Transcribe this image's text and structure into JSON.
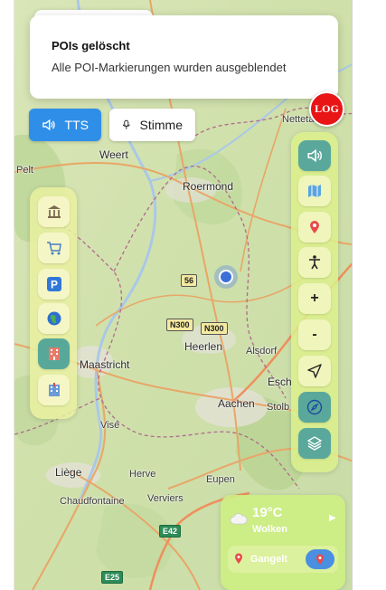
{
  "notification": {
    "title": "POIs gelöscht",
    "message": "Alle POI-Markierungen wurden ausgeblendet"
  },
  "log_button": {
    "label": "LOG"
  },
  "voice_controls": {
    "tts_label": "TTS",
    "voice_label": "Stimme"
  },
  "map": {
    "labels": {
      "weert": "Weert",
      "pelt": "Pelt",
      "roermond": "Roermond",
      "nettetal": "Nettetal",
      "heerlen": "Heerlen",
      "alsdorf": "Alsdorf",
      "maastricht": "Maastricht",
      "aachen": "Aachen",
      "eschweiler": "Esch",
      "stolberg": "Stolb",
      "vise": "Visé",
      "liege": "Liège",
      "herve": "Herve",
      "eupen": "Eupen",
      "chaudfontaine": "Chaudfontaine",
      "verviers": "Verviers"
    },
    "road_shields": {
      "r56": "56",
      "n300a": "N300",
      "n300b": "N300",
      "e42": "E42",
      "e25": "E25"
    }
  },
  "poi_panel": {
    "icons": [
      "museum-icon",
      "shopping-icon",
      "parking-icon",
      "globe-icon",
      "hotel-icon",
      "hospital-icon"
    ],
    "active_index": 4
  },
  "control_panel": {
    "buttons": [
      "speaker-icon",
      "map-icon",
      "pin-icon",
      "accessibility-icon",
      "zoom-in",
      "zoom-out",
      "navigate-icon",
      "compass-icon",
      "layers-icon"
    ],
    "zoom_in_label": "+",
    "zoom_out_label": "-"
  },
  "weather": {
    "temperature": "19°C",
    "condition": "Wolken",
    "location": "Gangelt"
  },
  "colors": {
    "accent_blue": "#2f8fe8",
    "log_red": "#e81416",
    "panel_green": "#dcf08c",
    "teal": "#5aa89b"
  }
}
